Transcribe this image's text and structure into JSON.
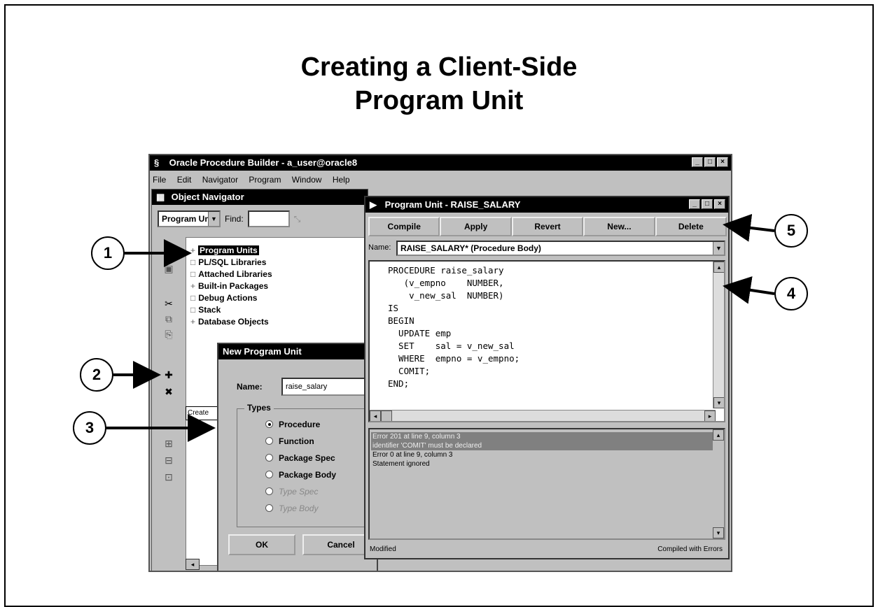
{
  "slide": {
    "title_line1": "Creating a Client-Side",
    "title_line2": "Program Unit"
  },
  "app_window": {
    "title": "Oracle Procedure Builder - a_user@oracle8",
    "menu": [
      "File",
      "Edit",
      "Navigator",
      "Program",
      "Window",
      "Help"
    ]
  },
  "navigator": {
    "title": "Object Navigator",
    "select_value": "Program Un",
    "find_label": "Find:",
    "tree": [
      {
        "label": "Program Units",
        "icon": "+",
        "selected": true
      },
      {
        "label": "PL/SQL Libraries",
        "icon": "□",
        "selected": false
      },
      {
        "label": "Attached Libraries",
        "icon": "□",
        "selected": false
      },
      {
        "label": "Built-in Packages",
        "icon": "+",
        "selected": false
      },
      {
        "label": "Debug Actions",
        "icon": "□",
        "selected": false
      },
      {
        "label": "Stack",
        "icon": "□",
        "selected": false
      },
      {
        "label": "Database Objects",
        "icon": "+",
        "selected": false
      }
    ],
    "create_label": "Create"
  },
  "new_unit_dialog": {
    "title": "New Program Unit",
    "name_label": "Name:",
    "name_value": "raise_salary",
    "types_label": "Types",
    "types": [
      {
        "label": "Procedure",
        "selected": true,
        "enabled": true
      },
      {
        "label": "Function",
        "selected": false,
        "enabled": true
      },
      {
        "label": "Package Spec",
        "selected": false,
        "enabled": true
      },
      {
        "label": "Package Body",
        "selected": false,
        "enabled": true
      },
      {
        "label": "Type Spec",
        "selected": false,
        "enabled": false
      },
      {
        "label": "Type Body",
        "selected": false,
        "enabled": false
      }
    ],
    "ok_label": "OK",
    "cancel_label": "Cancel"
  },
  "program_unit": {
    "title": "Program Unit - RAISE_SALARY",
    "buttons": [
      "Compile",
      "Apply",
      "Revert",
      "New...",
      "Delete"
    ],
    "name_label": "Name:",
    "name_value": "RAISE_SALARY* (Procedure Body)",
    "code_lines": [
      "PROCEDURE raise_salary",
      "   (v_empno    NUMBER,",
      "    v_new_sal  NUMBER)",
      "IS",
      "BEGIN",
      "  UPDATE emp",
      "  SET    sal = v_new_sal",
      "  WHERE  empno = v_empno;",
      "  COMIT;",
      "END;"
    ],
    "errors": [
      {
        "text": "Error 201 at line 9, column 3",
        "highlighted": true
      },
      {
        "text": "  identifier 'COMIT' must be declared",
        "highlighted": true
      },
      {
        "text": "Error 0 at line 9, column 3",
        "highlighted": false
      },
      {
        "text": "  Statement ignored",
        "highlighted": false
      }
    ],
    "status_left": "Modified",
    "status_right": "Compiled with Errors"
  },
  "callouts": [
    "1",
    "2",
    "3",
    "4",
    "5"
  ]
}
